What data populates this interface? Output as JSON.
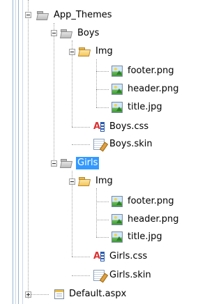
{
  "tree": {
    "app_themes": "App_Themes",
    "boys": {
      "folder": "Boys",
      "img_folder": "Img",
      "files": [
        "footer.png",
        "header.png",
        "title.jpg"
      ],
      "css": "Boys.css",
      "skin": "Boys.skin"
    },
    "girls": {
      "folder": "Girls",
      "img_folder": "Img",
      "files": [
        "footer.png",
        "header.png",
        "title.jpg"
      ],
      "css": "Girls.css",
      "skin": "Girls.skin"
    },
    "default_page": "Default.aspx"
  },
  "icons": {
    "folder": "folder-icon",
    "open_folder": "open-folder-icon",
    "image_file": "image-file-icon",
    "css_file": "css-file-icon",
    "skin_file": "skin-file-icon",
    "aspx_file": "aspx-file-icon"
  },
  "colors": {
    "selection": "#3399ff",
    "guide_line": "#98b4d3"
  }
}
